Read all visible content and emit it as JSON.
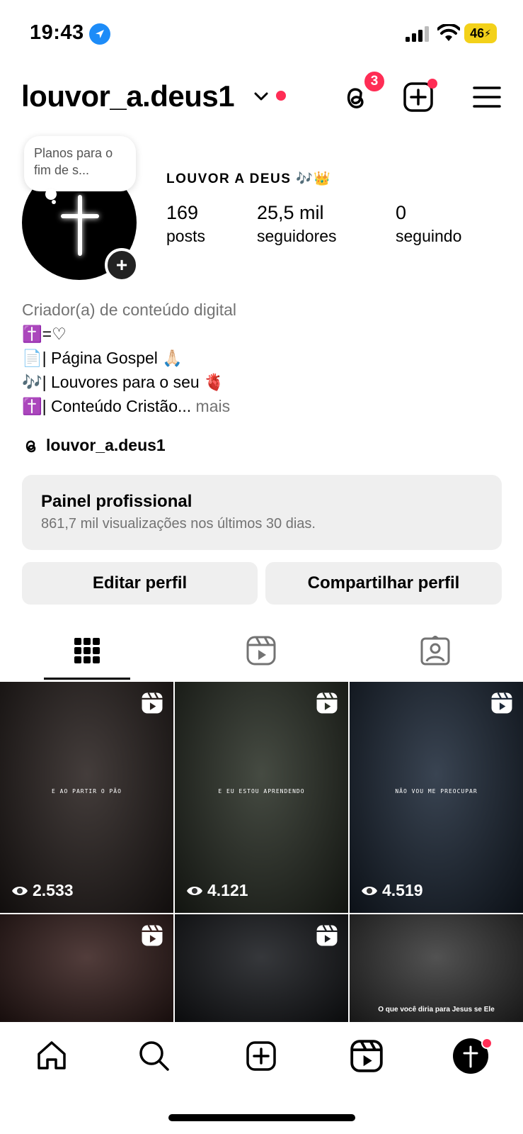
{
  "status_bar": {
    "time": "19:43",
    "battery": "46"
  },
  "header": {
    "username": "louvor_a.deus1",
    "threads_badge": "3"
  },
  "note": {
    "text": "Planos para o fim de s..."
  },
  "profile": {
    "display_name": "LOUVOR A DEUS 🎶👑",
    "stats": [
      {
        "value": "169",
        "label": "posts"
      },
      {
        "value": "25,5 mil",
        "label": "seguidores"
      },
      {
        "value": "0",
        "label": "seguindo"
      }
    ],
    "bio": {
      "category": "Criador(a) de conteúdo digital",
      "lines": [
        "✝️=♡",
        "📄| Página Gospel 🙏🏻",
        "🎶| Louvores para o seu 🫀",
        "✝️| Conteúdo Cristão..."
      ],
      "more": " mais"
    },
    "threads_handle": "louvor_a.deus1"
  },
  "panel": {
    "title": "Painel profissional",
    "subtitle": "861,7 mil visualizações nos últimos 30 dias."
  },
  "buttons": {
    "edit": "Editar perfil",
    "share": "Compartilhar perfil"
  },
  "grid": [
    {
      "views": "2.533",
      "caption": "E AO PARTIR O PÃO",
      "bg": "#2a2220"
    },
    {
      "views": "4.121",
      "caption": "E EU ESTOU APRENDENDO",
      "bg": "#2c3228"
    },
    {
      "views": "4.519",
      "caption": "NÃO VOU ME PREOCUPAR",
      "bg": "#1e2a3a"
    },
    {
      "views": "",
      "caption": "",
      "bg": "#3a2220"
    },
    {
      "views": "",
      "caption": "",
      "bg": "#1a1c20"
    },
    {
      "views": "",
      "caption": "O que você diria para Jesus se Ele",
      "bg": "#3a3a3a"
    }
  ]
}
